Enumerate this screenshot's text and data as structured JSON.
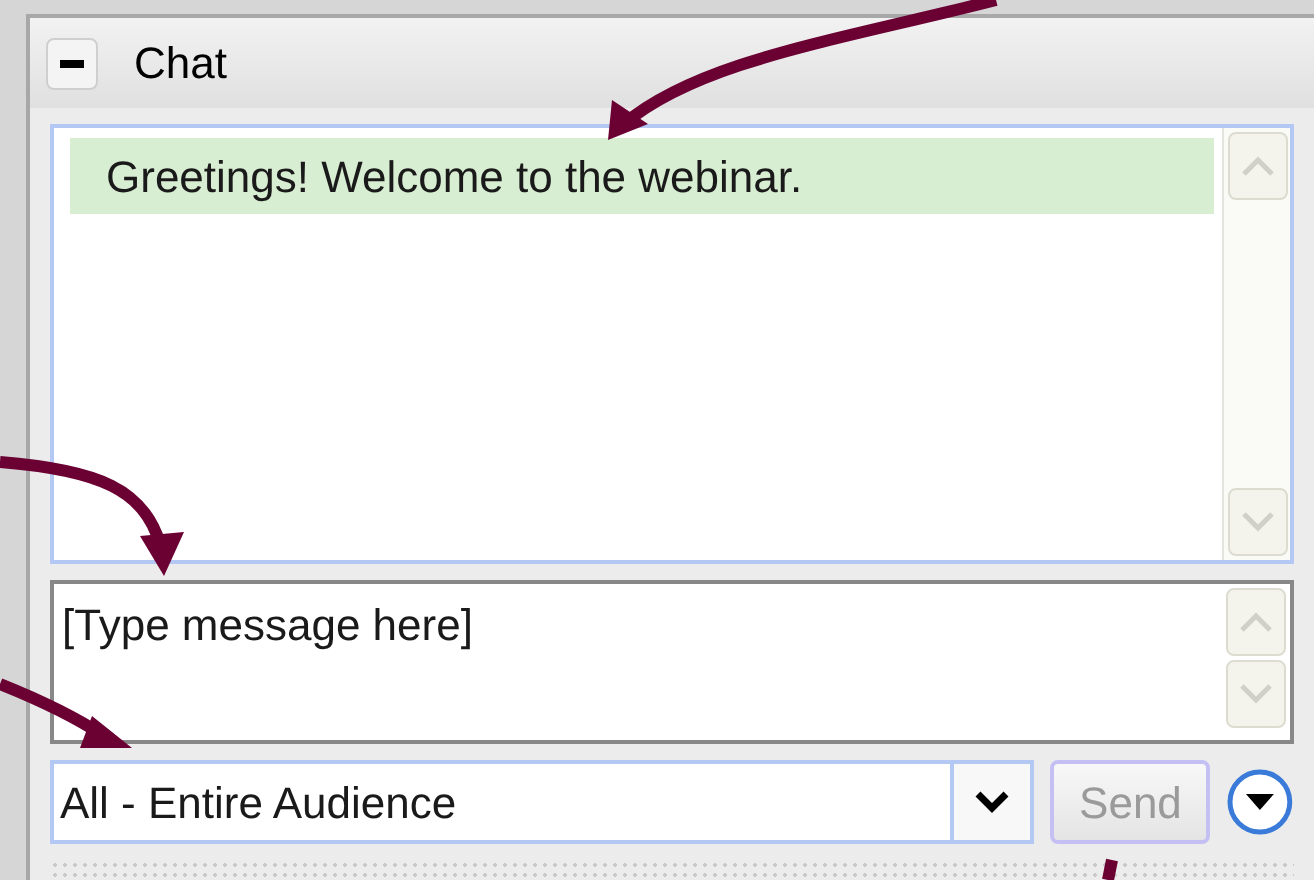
{
  "panel": {
    "title": "Chat",
    "expanded": true
  },
  "messages": [
    {
      "text": "Greetings! Welcome to the webinar.",
      "highlighted": true
    }
  ],
  "compose": {
    "placeholder": "[Type message here]"
  },
  "recipient": {
    "value": "All - Entire Audience"
  },
  "send_button": {
    "label": "Send",
    "disabled": true
  }
}
